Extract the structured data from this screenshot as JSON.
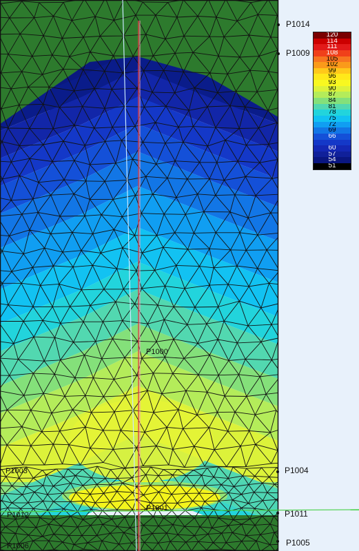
{
  "colors": {
    "page_background": "#e8f1fb",
    "mesh_lines": "#111111",
    "boundary_band": "#2d7a2d",
    "red_line": "#e0404a",
    "pink_line": "#f0a0b8",
    "cyan_line": "#c8e8ff",
    "green_line": "#46d046"
  },
  "legend": {
    "entries": [
      {
        "label": "120",
        "color": "#7a0000",
        "text_color": "#ffffff"
      },
      {
        "label": "114",
        "color": "#cc0000",
        "text_color": "#ffffff"
      },
      {
        "label": "111",
        "color": "#e21a1a",
        "text_color": "#ffffff"
      },
      {
        "label": "108",
        "color": "#f0401a",
        "text_color": "#ffffff"
      },
      {
        "label": "105",
        "color": "#f77520",
        "text_color": "#000000"
      },
      {
        "label": "102",
        "color": "#fa9a1a",
        "text_color": "#000000"
      },
      {
        "label": "99",
        "color": "#ffc81a",
        "text_color": "#000000"
      },
      {
        "label": "96",
        "color": "#ffe81a",
        "text_color": "#000000"
      },
      {
        "label": "93",
        "color": "#f8f820",
        "text_color": "#000000"
      },
      {
        "label": "90",
        "color": "#dcf23a",
        "text_color": "#000000"
      },
      {
        "label": "87",
        "color": "#b4ec5a",
        "text_color": "#000000"
      },
      {
        "label": "84",
        "color": "#84e07a",
        "text_color": "#000000"
      },
      {
        "label": "81",
        "color": "#52d8b0",
        "text_color": "#000000"
      },
      {
        "label": "78",
        "color": "#22d4dc",
        "text_color": "#000000"
      },
      {
        "label": "75",
        "color": "#12c2f2",
        "text_color": "#000000"
      },
      {
        "label": "72",
        "color": "#109ef2",
        "text_color": "#000000"
      },
      {
        "label": "69",
        "color": "#1276e6",
        "text_color": "#000000"
      },
      {
        "label": "66",
        "color": "#1450d8",
        "text_color": "#ffffff"
      },
      {
        "label": "",
        "color": "#1438c8",
        "text_color": "#ffffff"
      },
      {
        "label": "60",
        "color": "#1428b4",
        "text_color": "#ffffff"
      },
      {
        "label": "57",
        "color": "#10209a",
        "text_color": "#ffffff"
      },
      {
        "label": "54",
        "color": "#0a1680",
        "text_color": "#ffffff"
      },
      {
        "label": "51",
        "color": "#000000",
        "text_color": "#ffffff"
      }
    ]
  },
  "points": {
    "p1014": "P1014",
    "p1009": "P1009",
    "p1004": "P1004",
    "p1011": "P1011",
    "p1005": "P1005",
    "p1000": "P1000",
    "p1001": "P1001",
    "p1003": "P1003",
    "p1012": "P1012",
    "p1006": "P1006"
  }
}
